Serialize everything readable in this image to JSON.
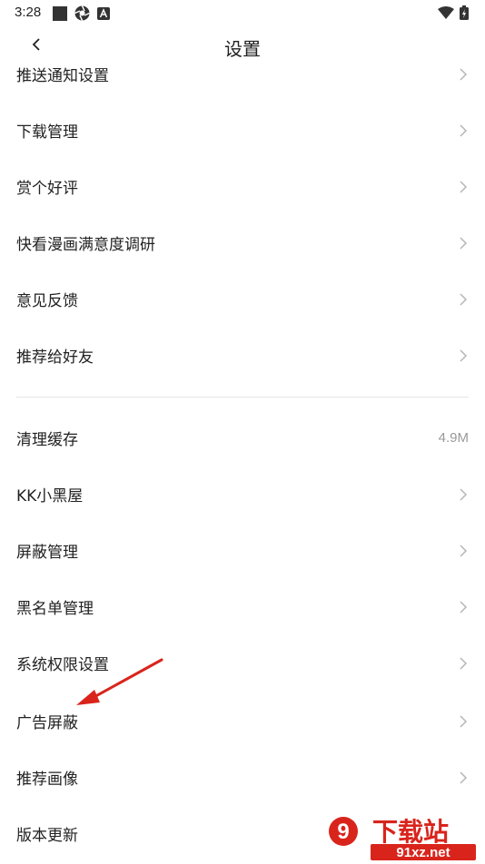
{
  "status_bar": {
    "time": "3:28"
  },
  "header": {
    "title": "设置",
    "back_icon": "chevron-left-icon"
  },
  "settings": [
    {
      "label": "推送通知设置",
      "value": ""
    },
    {
      "label": "下载管理",
      "value": ""
    },
    {
      "label": "赏个好评",
      "value": ""
    },
    {
      "label": "快看漫画满意度调研",
      "value": ""
    },
    {
      "label": "意见反馈",
      "value": ""
    },
    {
      "label": "推荐给好友",
      "value": ""
    },
    {
      "label": "清理缓存",
      "value": "4.9M"
    },
    {
      "label": "KK小黑屋",
      "value": ""
    },
    {
      "label": "屏蔽管理",
      "value": ""
    },
    {
      "label": "黑名单管理",
      "value": ""
    },
    {
      "label": "系统权限设置",
      "value": ""
    },
    {
      "label": "广告屏蔽",
      "value": ""
    },
    {
      "label": "推荐画像",
      "value": ""
    },
    {
      "label": "版本更新",
      "value": ""
    }
  ],
  "annotation": {
    "color": "#d9241c"
  },
  "watermark": {
    "brand": "下载站",
    "site": "91xz.net",
    "logo": "9",
    "color": "#d9241c"
  },
  "colors": {
    "text": "#222222",
    "secondary": "#999999",
    "chevron": "#b5b5b5",
    "divider": "#e6e6e6"
  }
}
